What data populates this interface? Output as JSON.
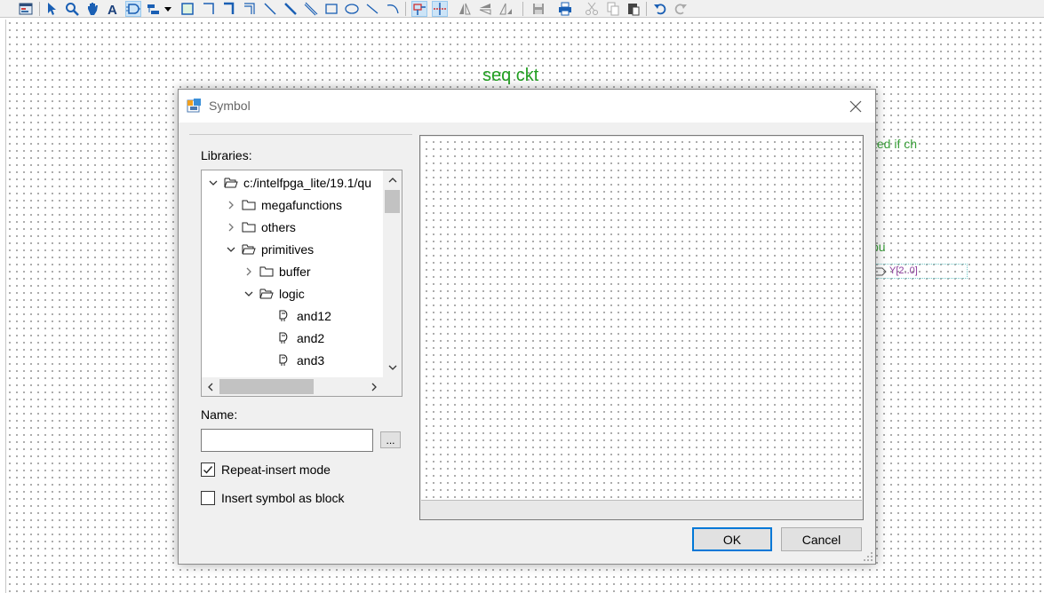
{
  "toolbar": {
    "tools": [
      "window-icon",
      "select-arrow-icon",
      "zoom-icon",
      "hand-icon",
      "text-tool-icon",
      "symbol-tool-icon",
      "pin-tool-icon",
      "dropdown-arrow-icon",
      "block-tool-icon",
      "orthogonal-node-icon",
      "orthogonal-bus-icon",
      "orthogonal-conduit-icon",
      "node-line-icon",
      "bus-line-icon",
      "conduit-line-icon",
      "rectangle-icon",
      "ellipse-icon",
      "line-icon",
      "arc-icon",
      "rubberbanding-icon",
      "partial-line-select-icon",
      "flip-horizontal-icon",
      "flip-vertical-icon",
      "rotate-icon",
      "save-icon",
      "print-icon",
      "cut-icon",
      "copy-icon",
      "paste-icon",
      "undo-icon",
      "redo-icon"
    ]
  },
  "canvas": {
    "title": "seq  ckt",
    "note": "ted if ch",
    "label_ou": "ou",
    "pin_label": "Y[2..0]"
  },
  "dialog": {
    "title": "Symbol",
    "libraries_label": "Libraries:",
    "tree": [
      {
        "label": "c:/intelfpga_lite/19.1/qu",
        "depth": 0,
        "expanded": true,
        "icon": "folder-open-icon"
      },
      {
        "label": "megafunctions",
        "depth": 1,
        "expanded": false,
        "icon": "folder-icon"
      },
      {
        "label": "others",
        "depth": 1,
        "expanded": false,
        "icon": "folder-icon"
      },
      {
        "label": "primitives",
        "depth": 1,
        "expanded": true,
        "icon": "folder-open-icon"
      },
      {
        "label": "buffer",
        "depth": 2,
        "expanded": false,
        "icon": "folder-icon"
      },
      {
        "label": "logic",
        "depth": 2,
        "expanded": true,
        "icon": "folder-open-icon"
      },
      {
        "label": "and12",
        "depth": 3,
        "icon": "gate-symbol-icon"
      },
      {
        "label": "and2",
        "depth": 3,
        "icon": "gate-symbol-icon"
      },
      {
        "label": "and3",
        "depth": 3,
        "icon": "gate-symbol-icon"
      }
    ],
    "name_label": "Name:",
    "name_value": "",
    "browse_label": "...",
    "repeat_insert_label": "Repeat-insert mode",
    "repeat_insert_checked": true,
    "insert_block_label": "Insert symbol as block",
    "insert_block_checked": false,
    "ok_label": "OK",
    "cancel_label": "Cancel",
    "accent_color": "#0078d7"
  }
}
